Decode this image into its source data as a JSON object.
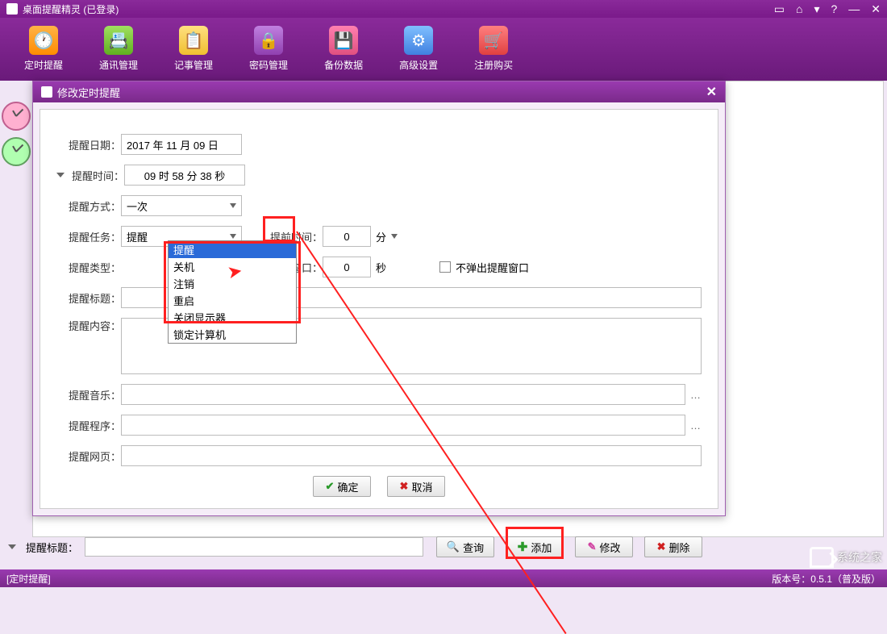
{
  "app": {
    "title": "桌面提醒精灵  (已登录)"
  },
  "toolbar": {
    "items": [
      {
        "label": "定时提醒"
      },
      {
        "label": "通讯管理"
      },
      {
        "label": "记事管理"
      },
      {
        "label": "密码管理"
      },
      {
        "label": "备份数据"
      },
      {
        "label": "高级设置"
      },
      {
        "label": "注册购买"
      }
    ]
  },
  "dialog": {
    "title": "修改定时提醒",
    "labels": {
      "date": "提醒日期",
      "time": "提醒时间",
      "mode": "提醒方式",
      "task": "提醒任务",
      "advance": "提前时间",
      "type": "提醒类型",
      "closewin": "关闭窗口",
      "title_field": "提醒标题",
      "content": "提醒内容",
      "music": "提醒音乐",
      "program": "提醒程序",
      "url": "提醒网页"
    },
    "values": {
      "date": "2017 年 11 月 09 日",
      "time": "09 时 58 分 38 秒",
      "mode": "一次",
      "task": "提醒",
      "advance": "0",
      "advance_unit": "分",
      "closewin": "0",
      "closewin_unit": "秒",
      "no_popup_label": "不弹出提醒窗口",
      "title_field": "",
      "content": "",
      "music": "",
      "program": "",
      "url": ""
    },
    "task_options": [
      "提醒",
      "关机",
      "注销",
      "重启",
      "关闭显示器",
      "锁定计算机"
    ],
    "buttons": {
      "ok": "确定",
      "cancel": "取消"
    }
  },
  "bottom": {
    "search_label": "提醒标题",
    "buttons": {
      "query": "查询",
      "add": "添加",
      "modify": "修改",
      "delete": "删除"
    }
  },
  "status": {
    "left": "[定时提醒]",
    "right": "版本号：0.5.1（普及版）"
  },
  "watermark": "系统之家"
}
